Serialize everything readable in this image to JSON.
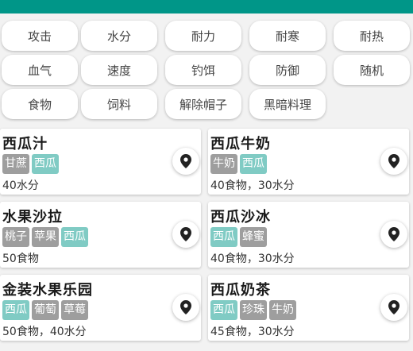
{
  "colors": {
    "topbar": "#009688",
    "tag_gray": "#9e9e9e",
    "tag_teal": "#80cbc4"
  },
  "filters": [
    {
      "label": "攻击"
    },
    {
      "label": "水分"
    },
    {
      "label": "耐力"
    },
    {
      "label": "耐寒"
    },
    {
      "label": "耐热"
    },
    {
      "label": "血气"
    },
    {
      "label": "速度"
    },
    {
      "label": "钓饵"
    },
    {
      "label": "防御"
    },
    {
      "label": "随机"
    },
    {
      "label": "食物"
    },
    {
      "label": "饲料"
    },
    {
      "label": "解除帽子"
    },
    {
      "label": "黑暗料理"
    }
  ],
  "recipes": [
    {
      "name": "西瓜汁",
      "tags": [
        {
          "label": "甘蔗",
          "color": "gray"
        },
        {
          "label": "西瓜",
          "color": "teal"
        }
      ],
      "effect": "40水分",
      "icon": "location-pin-icon"
    },
    {
      "name": "西瓜牛奶",
      "tags": [
        {
          "label": "牛奶",
          "color": "gray"
        },
        {
          "label": "西瓜",
          "color": "teal"
        }
      ],
      "effect": "40食物，30水分",
      "icon": "location-pin-icon"
    },
    {
      "name": "水果沙拉",
      "tags": [
        {
          "label": "桃子",
          "color": "gray"
        },
        {
          "label": "苹果",
          "color": "gray"
        },
        {
          "label": "西瓜",
          "color": "teal"
        }
      ],
      "effect": "50食物",
      "icon": "location-pin-icon"
    },
    {
      "name": "西瓜沙冰",
      "tags": [
        {
          "label": "西瓜",
          "color": "teal"
        },
        {
          "label": "蜂蜜",
          "color": "gray"
        }
      ],
      "effect": "40食物，30水分",
      "icon": "location-pin-icon"
    },
    {
      "name": "金装水果乐园",
      "tags": [
        {
          "label": "西瓜",
          "color": "teal"
        },
        {
          "label": "葡萄",
          "color": "gray"
        },
        {
          "label": "草莓",
          "color": "gray"
        }
      ],
      "effect": "50食物，40水分",
      "icon": "location-pin-icon"
    },
    {
      "name": "西瓜奶茶",
      "tags": [
        {
          "label": "西瓜",
          "color": "teal"
        },
        {
          "label": "珍珠",
          "color": "gray"
        },
        {
          "label": "牛奶",
          "color": "gray"
        }
      ],
      "effect": "45食物，30水分",
      "icon": "location-pin-icon"
    }
  ]
}
